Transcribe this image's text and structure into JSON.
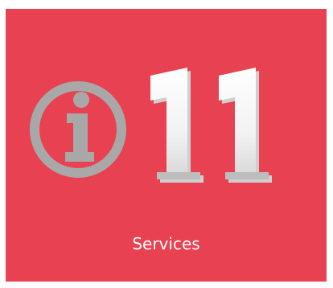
{
  "tile": {
    "label": "Services",
    "background": "#e84252",
    "logo_icon": "info-circle-icon",
    "logo_numerals": "11",
    "logo_ring_color": "#a8a8a8",
    "numeral_color": "#ffffff"
  }
}
